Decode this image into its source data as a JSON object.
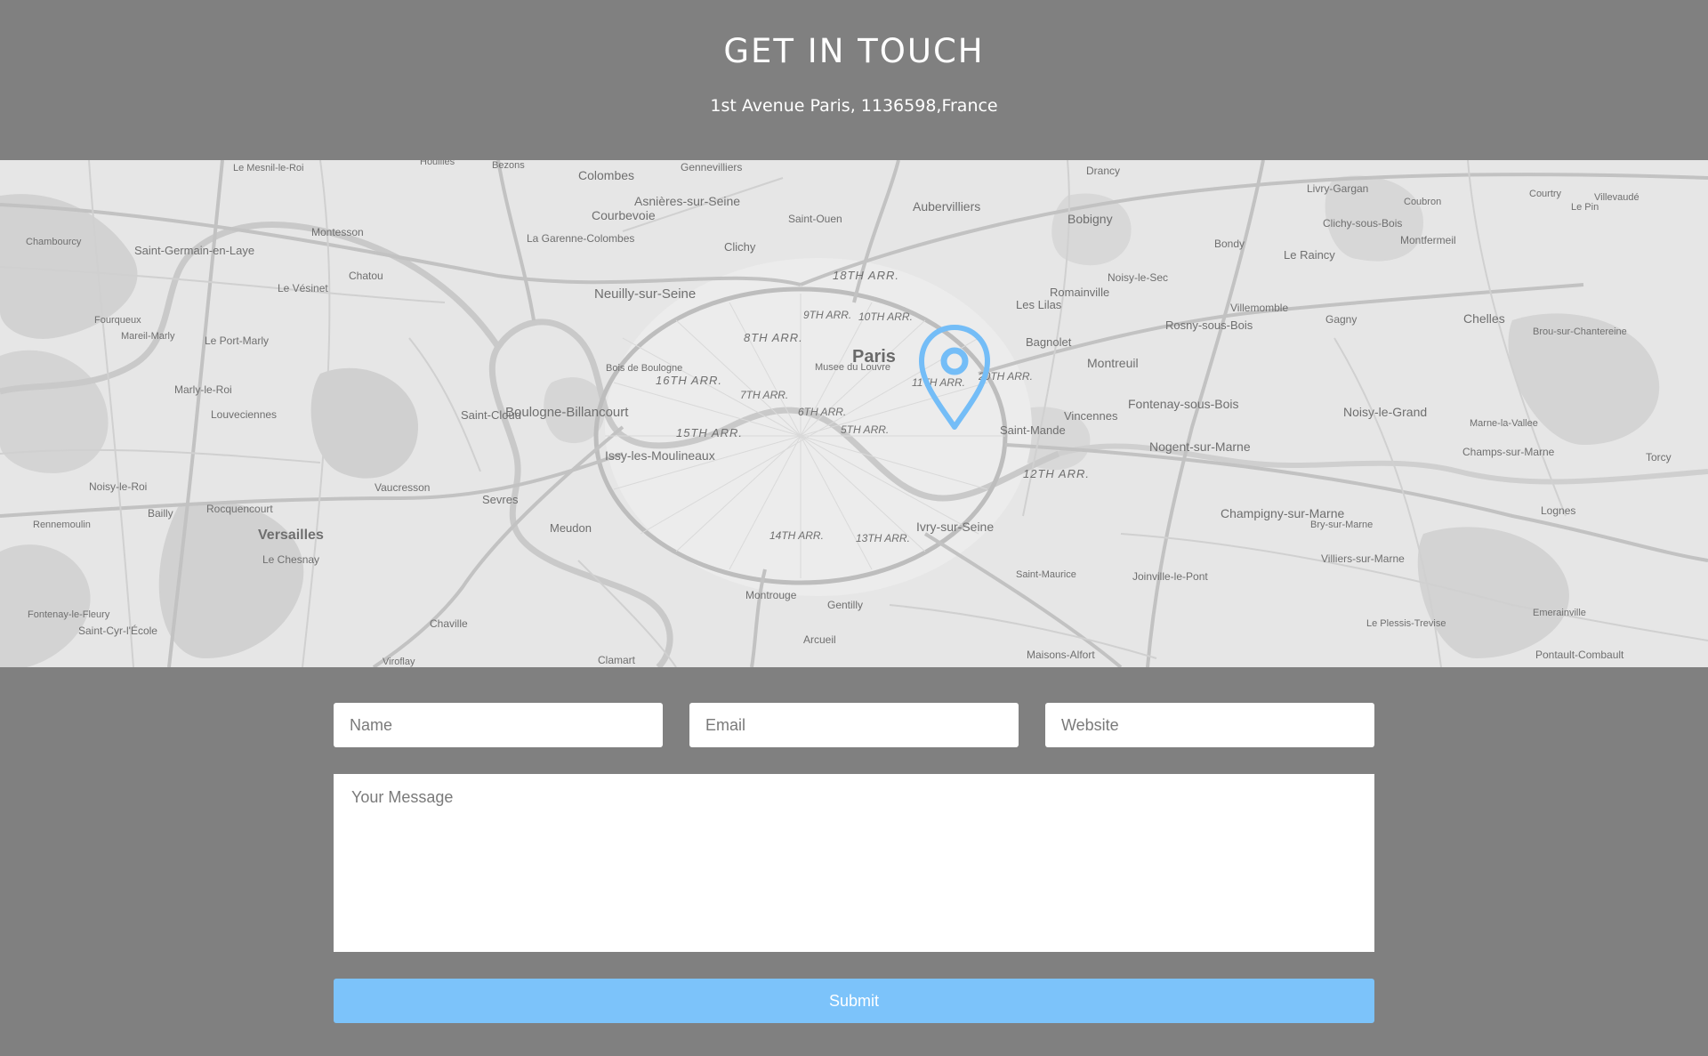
{
  "header": {
    "title": "GET IN TOUCH",
    "address": "1st Avenue Paris, 1136598,France"
  },
  "map": {
    "pin_icon": "map-pin-icon",
    "pin_color": "#74bdf7",
    "labels": {
      "paris": "Paris",
      "neuilly": "Neuilly-sur-Seine",
      "boulogne": "Boulogne-Billancourt",
      "issy": "Issy-les-Moulineaux",
      "versailles": "Versailles",
      "courbevoie": "Courbevoie",
      "colombes": "Colombes",
      "asnieres": "Asnières-sur-Seine",
      "aubervilliers": "Aubervilliers",
      "bobigny": "Bobigny",
      "montreuil": "Montreuil",
      "vincennes": "Vincennes",
      "saint_cloud": "Saint-Cloud",
      "ivry": "Ivry-sur-Seine",
      "fontenay": "Fontenay-sous-Bois",
      "nogent": "Nogent-sur-Marne",
      "champigny": "Champigny-sur-Marne",
      "noisy_le_grand": "Noisy-le-Grand",
      "rosny": "Rosny-sous-Bois",
      "saint_germain": "Saint-Germain-en-Laye",
      "meudon": "Meudon",
      "sevres": "Sevres",
      "chelles": "Chelles",
      "montfermeil": "Montfermeil",
      "le_raincy": "Le Raincy",
      "romainville": "Romainville",
      "bagnolet": "Bagnolet",
      "les_lilas": "Les Lilas",
      "saint_mande": "Saint-Mande",
      "arr18": "18TH ARR.",
      "arr8": "8TH ARR.",
      "arr16": "16TH ARR.",
      "arr15": "15TH ARR.",
      "arr12": "12TH ARR.",
      "arr20": "20TH ARR.",
      "arr11": "11TH ARR.",
      "arr9": "9TH ARR.",
      "arr10": "10TH ARR.",
      "arr7": "7TH ARR.",
      "arr6": "6TH ARR.",
      "arr5": "5TH ARR.",
      "arr14": "14TH ARR.",
      "arr13": "13TH ARR.",
      "louvre": "Musee du Louvre",
      "bois": "Bois de Boulogne",
      "montrouge": "Montrouge",
      "gentilly": "Gentilly",
      "clamart": "Clamart",
      "chaville": "Chaville",
      "vaucresson": "Vaucresson",
      "le_chesnay": "Le Chesnay",
      "rocquencourt": "Rocquencourt",
      "bailly": "Bailly",
      "noisy_le_roi": "Noisy-le-Roi",
      "louveciennes": "Louveciennes",
      "marly": "Marly-le-Roi",
      "le_port_marly": "Le Port-Marly",
      "chatou": "Chatou",
      "le_vesinet": "Le Vésinet",
      "montesson": "Montesson",
      "la_garenne": "La Garenne-Colombes",
      "clichy": "Clichy",
      "saint_ouen": "Saint-Ouen",
      "gennevilliers": "Gennevilliers",
      "bondy": "Bondy",
      "drancy": "Drancy",
      "livry": "Livry-Gargan",
      "clichy_sous_bois": "Clichy-sous-Bois",
      "gagny": "Gagny",
      "villemomble": "Villemomble",
      "noisy_le_sec": "Noisy-le-Sec",
      "joinville": "Joinville-le-Pont",
      "saint_maurice": "Saint-Maurice",
      "maisons_alfort": "Maisons-Alfort",
      "arcueil": "Arcueil",
      "villiers": "Villiers-sur-Marne",
      "bry": "Bry-sur-Marne",
      "torcy": "Torcy",
      "lognes": "Lognes",
      "emerainville": "Emerainville",
      "pontault": "Pontault-Combault",
      "champs": "Champs-sur-Marne",
      "marne_la_vallee": "Marne-la-Vallee",
      "brou": "Brou-sur-Chantereine",
      "courtry": "Courtry",
      "coubron": "Coubron",
      "viroflay": "Viroflay",
      "fontenay_fleury": "Fontenay-le-Fleury",
      "saint_cyr": "Saint-Cyr-l'École",
      "rennemoulin": "Rennemoulin",
      "chambourcy": "Chambourcy",
      "fourqueux": "Fourqueux",
      "mareil": "Mareil-Marly",
      "le_mesnil": "Le Mesnil-le-Roi",
      "bezons": "Bezons",
      "houilles": "Houilles",
      "le_plessis": "Le Plessis-Trevise",
      "villevaude": "Villevaudé",
      "le_pin": "Le Pin"
    }
  },
  "form": {
    "name_placeholder": "Name",
    "email_placeholder": "Email",
    "website_placeholder": "Website",
    "message_placeholder": "Your Message",
    "submit_label": "Submit",
    "submit_color": "#7cc3fa"
  }
}
